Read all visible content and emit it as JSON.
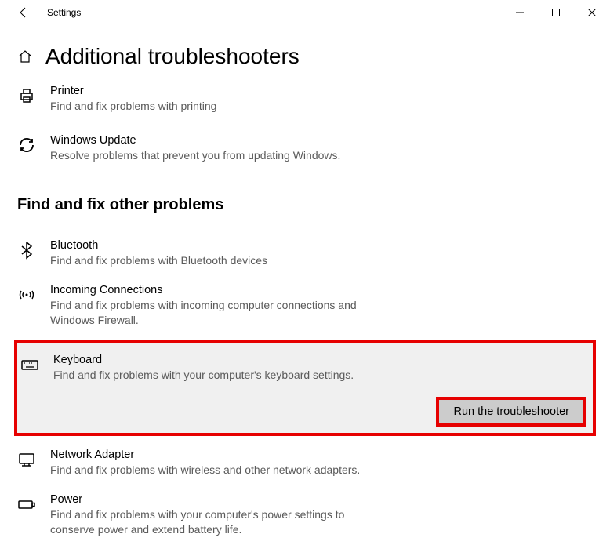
{
  "window": {
    "title": "Settings"
  },
  "page": {
    "title": "Additional troubleshooters"
  },
  "top_items": [
    {
      "icon": "printer",
      "title": "Printer",
      "desc": "Find and fix problems with printing"
    },
    {
      "icon": "update",
      "title": "Windows Update",
      "desc": "Resolve problems that prevent you from updating Windows."
    }
  ],
  "section": {
    "header": "Find and fix other problems"
  },
  "other_items": [
    {
      "icon": "bluetooth",
      "title": "Bluetooth",
      "desc": "Find and fix problems with Bluetooth devices"
    },
    {
      "icon": "incoming",
      "title": "Incoming Connections",
      "desc": "Find and fix problems with incoming computer connections and Windows Firewall."
    },
    {
      "icon": "keyboard",
      "title": "Keyboard",
      "desc": "Find and fix problems with your computer's keyboard settings.",
      "highlighted": true,
      "button": "Run the troubleshooter"
    },
    {
      "icon": "network",
      "title": "Network Adapter",
      "desc": "Find and fix problems with wireless and other network adapters."
    },
    {
      "icon": "power",
      "title": "Power",
      "desc": "Find and fix problems with your computer's power settings to conserve power and extend battery life."
    }
  ]
}
